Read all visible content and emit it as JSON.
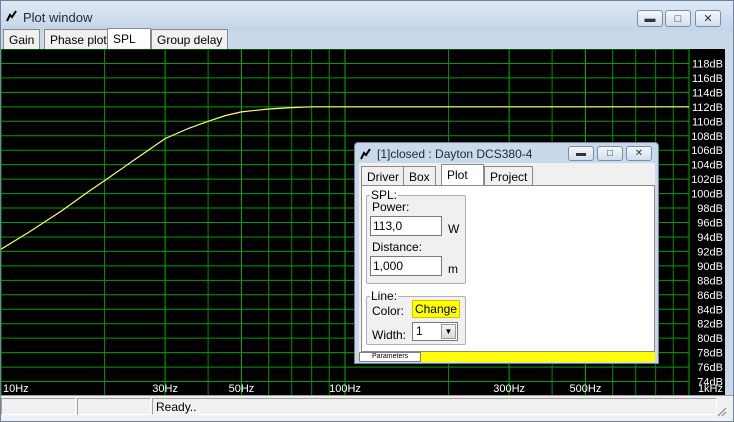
{
  "window": {
    "title": "Plot window"
  },
  "tabs": [
    {
      "label": "Gain"
    },
    {
      "label": "Phase plot"
    },
    {
      "label": "SPL"
    },
    {
      "label": "Group delay"
    }
  ],
  "status": {
    "text": "Ready.."
  },
  "colors": {
    "grid": "#00a000",
    "curve": "#ffff66",
    "background": "#000000",
    "accent": "#ffff00"
  },
  "chart_data": {
    "type": "line",
    "title": "",
    "xlabel": "",
    "ylabel": "",
    "x_scale": "log",
    "xlim": [
      10,
      1000
    ],
    "ylim": [
      72,
      120
    ],
    "grid": true,
    "x_tick_labels": [
      "10Hz",
      "30Hz",
      "50Hz",
      "100Hz",
      "300Hz",
      "500Hz",
      "1kHz"
    ],
    "x_tick_values": [
      10,
      30,
      50,
      100,
      300,
      500,
      1000
    ],
    "y_tick_labels": [
      "74dB",
      "76dB",
      "78dB",
      "80dB",
      "82dB",
      "84dB",
      "86dB",
      "88dB",
      "90dB",
      "92dB",
      "94dB",
      "96dB",
      "98dB",
      "100dB",
      "102dB",
      "104dB",
      "106dB",
      "108dB",
      "110dB",
      "112dB",
      "114dB",
      "116dB",
      "118dB"
    ],
    "y_tick_values": [
      74,
      76,
      78,
      80,
      82,
      84,
      86,
      88,
      90,
      92,
      94,
      96,
      98,
      100,
      102,
      104,
      106,
      108,
      110,
      112,
      114,
      116,
      118
    ],
    "series": [
      {
        "x": [
          10,
          12,
          15,
          18,
          20,
          25,
          30,
          35,
          40,
          45,
          50,
          60,
          70,
          80,
          100,
          150,
          200,
          300,
          500,
          1000
        ],
        "y": [
          92.3,
          94.6,
          97.6,
          100.3,
          101.8,
          105.0,
          107.6,
          109.0,
          110.0,
          110.8,
          111.3,
          111.7,
          111.9,
          112.0,
          112.0,
          112.0,
          112.0,
          112.0,
          112.0,
          112.0
        ]
      }
    ]
  },
  "dialog": {
    "title": "[1]closed : Dayton DCS380-4",
    "tabs": [
      {
        "label": "Driver"
      },
      {
        "label": "Box"
      },
      {
        "label": "Plot"
      },
      {
        "label": "Project"
      }
    ],
    "spl_group": "SPL:",
    "power_label": "Power:",
    "power_value": "113,0",
    "power_unit": "W",
    "distance_label": "Distance:",
    "distance_value": "1,000",
    "distance_unit": "m",
    "line_group": "Line:",
    "color_label": "Color:",
    "change_label": "Change",
    "width_label": "Width:",
    "width_value": "1",
    "parameters_tab": "Parameters"
  }
}
